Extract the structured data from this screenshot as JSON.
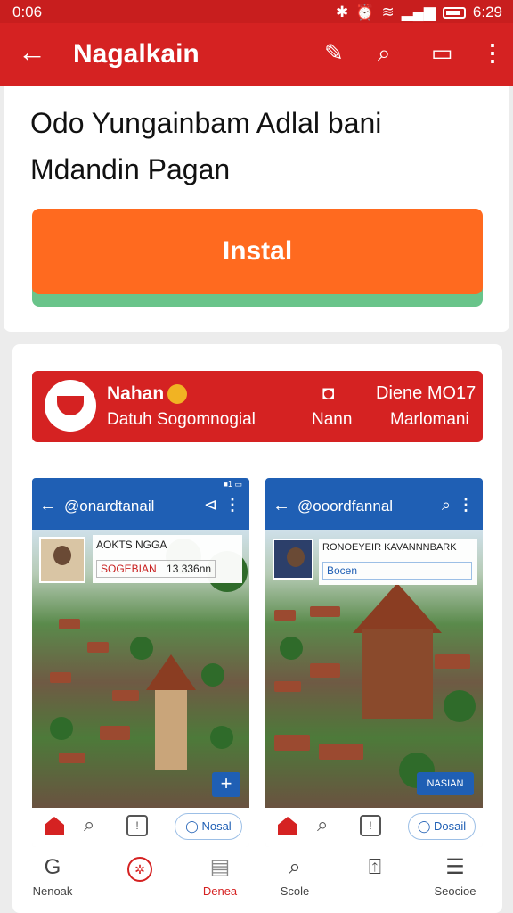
{
  "status_bar": {
    "time": "0:06",
    "clock": "6:29"
  },
  "app_bar": {
    "title": "Nagalkain",
    "back_icon": "arrow-left-icon",
    "actions": [
      "edit-icon",
      "search-icon",
      "book-icon",
      "more-vert-icon"
    ]
  },
  "card": {
    "description_line1": "Odo Yungainbam Adlal bani",
    "description_line2": "Mdandin Pagan",
    "install_label": "Instal",
    "accent_color": "#ff6a1f"
  },
  "banner": {
    "name": "Nahan",
    "subtitle": "Datuh Sogomnogial",
    "mid_label": "Nann",
    "right_line1": "Diene MO17",
    "right_line2": "Marlomani",
    "color": "#d52222"
  },
  "previews": [
    {
      "title": "@onardtanail",
      "mini_status": "■1 ▭",
      "card_title": "AOKTS NGGA",
      "card_tag": "SOGEBIAN",
      "card_value": "13 336nn",
      "fab_label": "+",
      "pill_label": "Nosal"
    },
    {
      "title": "@ooordfannal",
      "card_title": "RONOEYEIR KAVANNNBARK",
      "card_tag": "Bocen",
      "chip_label": "NASIAN",
      "pill_label": "Dosail"
    }
  ],
  "bottom_nav": {
    "items": [
      {
        "label": "Nenoak",
        "icon": "G"
      },
      {
        "label": "",
        "icon": "✲"
      },
      {
        "label": "Denea",
        "icon": "▤"
      },
      {
        "label": "Scole",
        "icon": "⌕"
      },
      {
        "label": "",
        "icon": "⍐"
      },
      {
        "label": "Seocioe",
        "icon": "☰"
      }
    ]
  }
}
